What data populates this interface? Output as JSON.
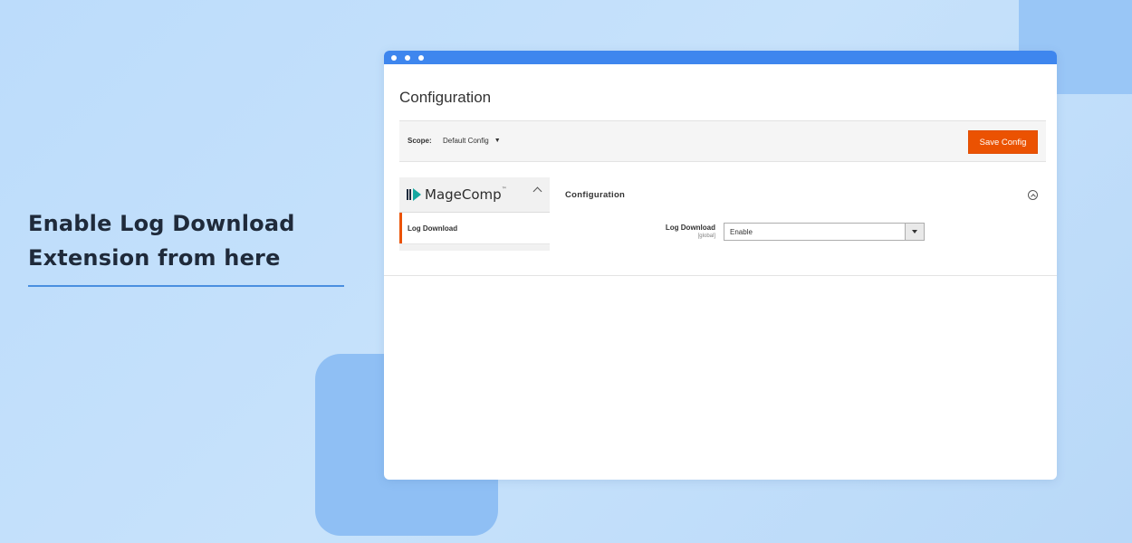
{
  "headline": {
    "line1": "Enable Log Download",
    "line2": "Extension from here"
  },
  "colors": {
    "accent": "#eb5202",
    "titlebar": "#3e86ee",
    "underline": "#4a8fe0"
  },
  "window": {
    "page_title": "Configuration",
    "scope": {
      "label": "Scope:",
      "value": "Default Config"
    },
    "save_label": "Save Config",
    "sidebar": {
      "brand": "MageComp",
      "brand_tm": "™",
      "items": [
        {
          "label": "Log Download"
        }
      ]
    },
    "section": {
      "title": "Configuration",
      "field": {
        "label": "Log Download",
        "scope": "[global]",
        "value": "Enable"
      }
    }
  }
}
